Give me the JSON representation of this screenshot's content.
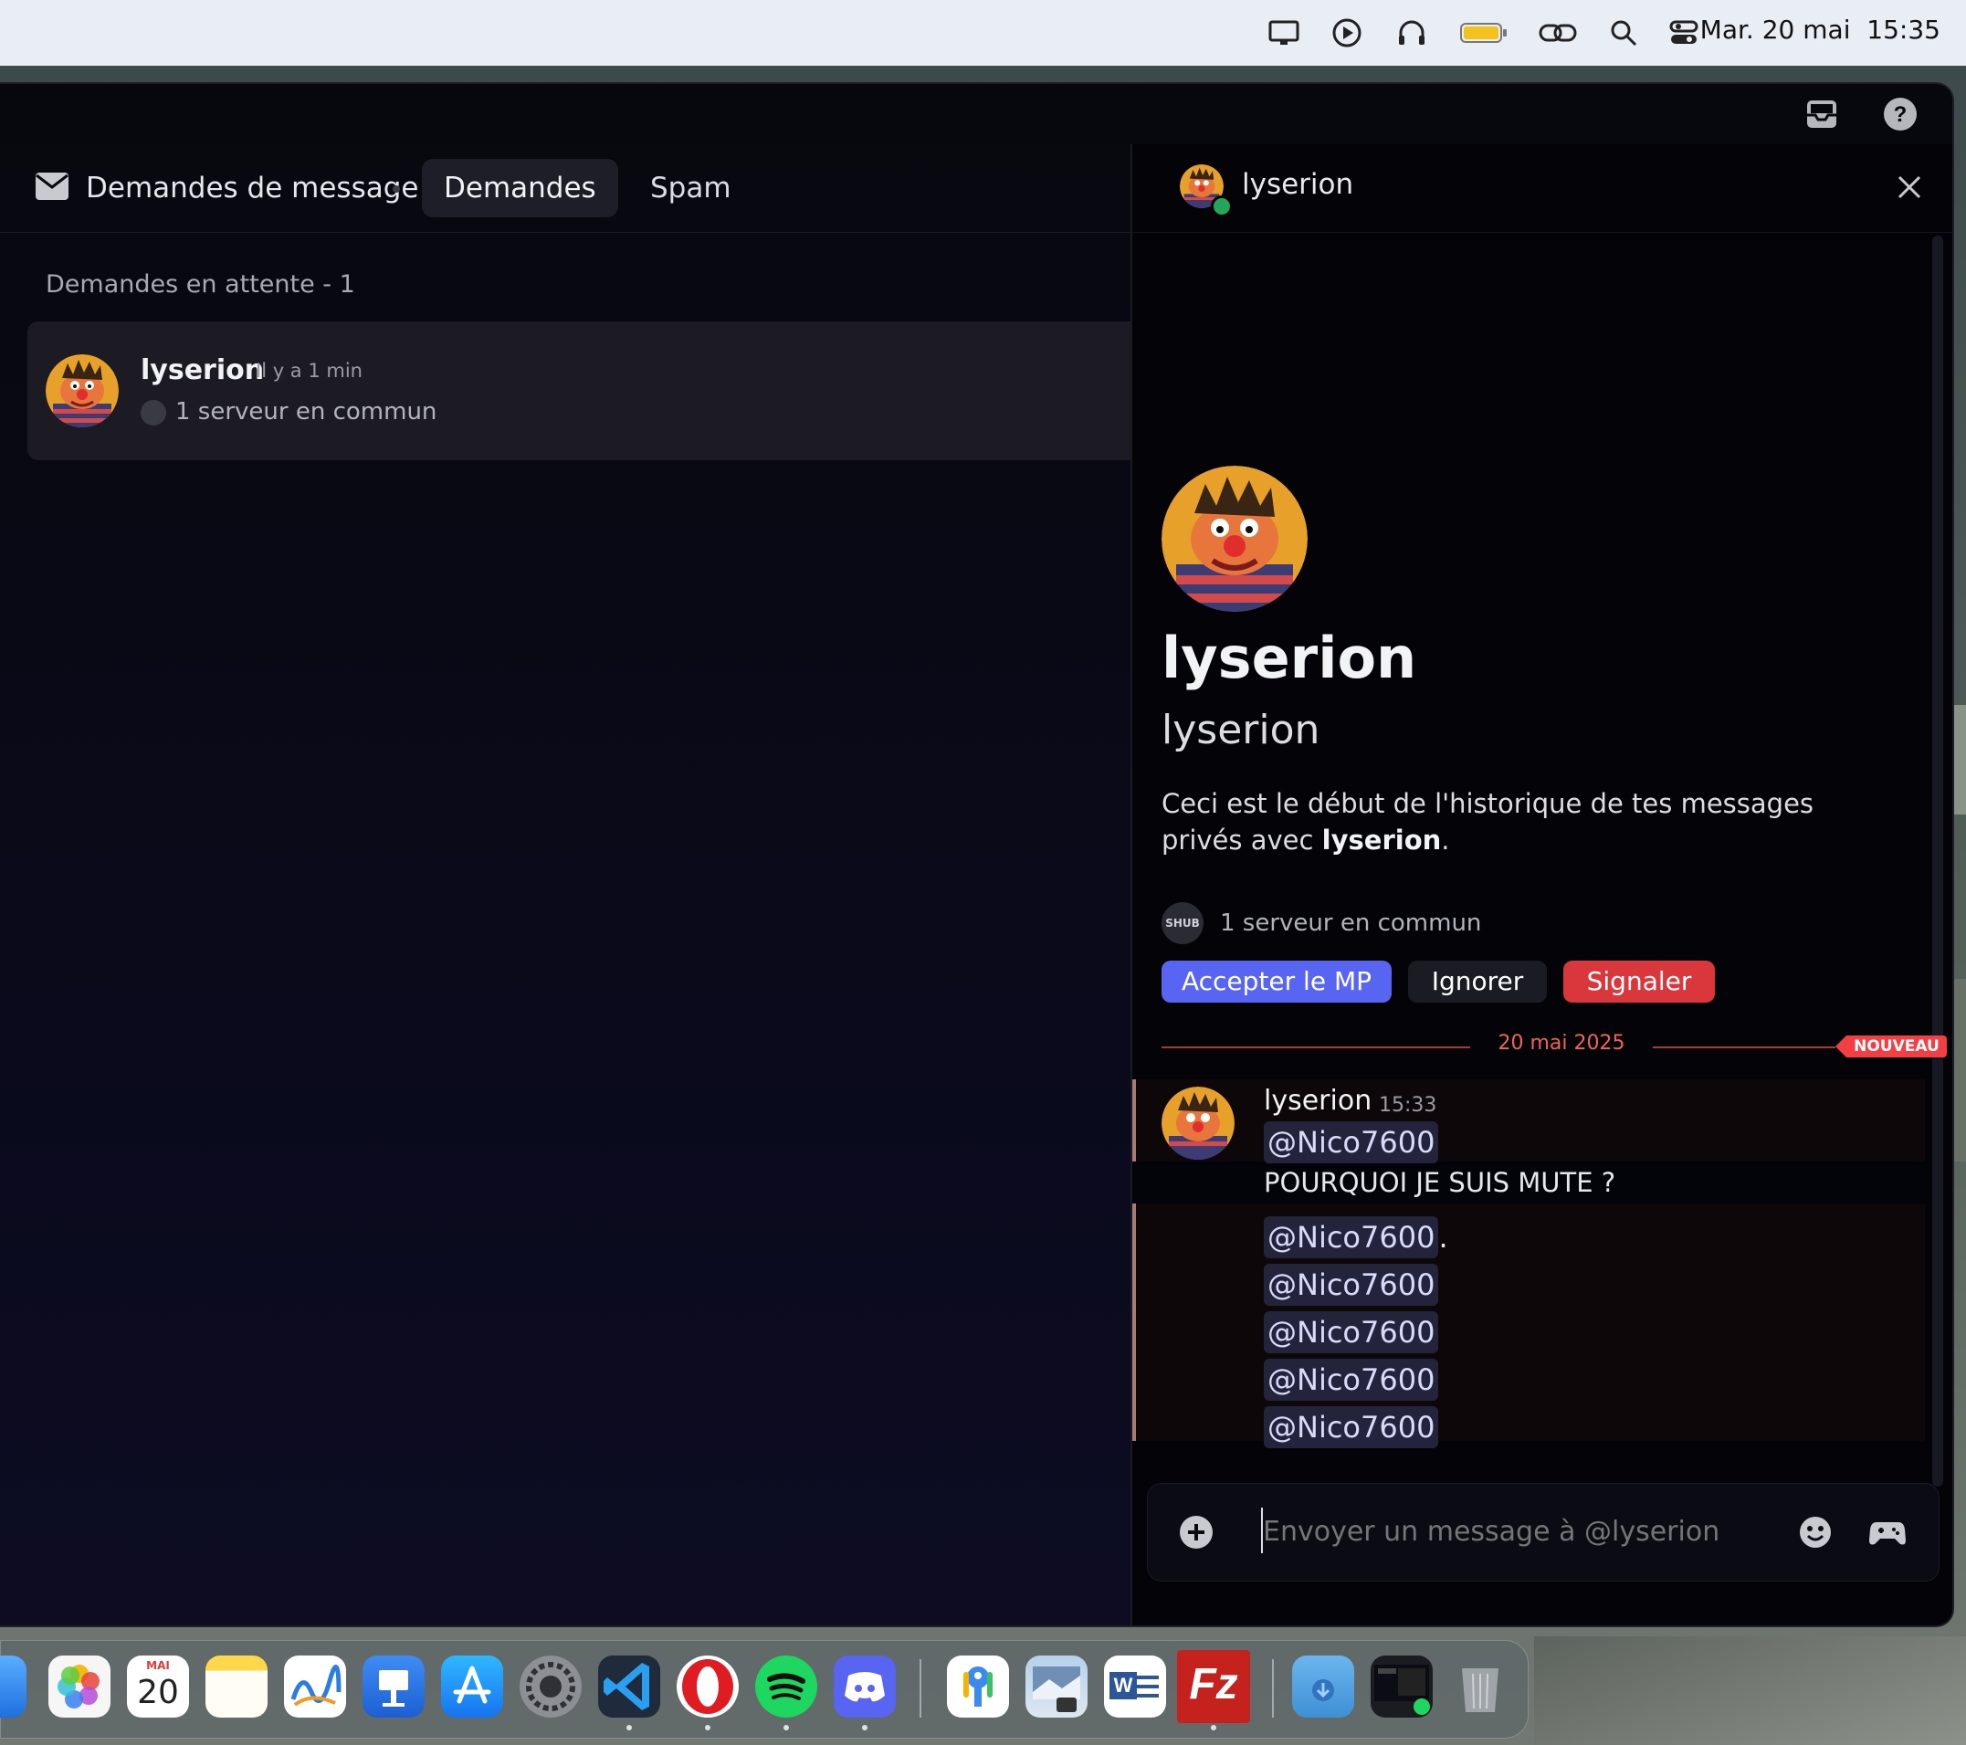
{
  "menubar": {
    "date": "Mar. 20 mai",
    "time": "15:35",
    "icons": [
      "display-icon",
      "play-circle-icon",
      "headphones-icon",
      "battery-icon",
      "link-icon",
      "search-icon",
      "control-center-icon"
    ]
  },
  "window": {
    "toolbar_icons": [
      "inbox-icon",
      "help-icon"
    ]
  },
  "left": {
    "header_title": "Demandes de message",
    "tabs": [
      {
        "label": "Demandes"
      },
      {
        "label": "Spam"
      }
    ],
    "section_title": "Demandes en attente - 1",
    "request": {
      "username": "lyserion",
      "time_ago": "Il y a 1 min",
      "mutual": "1 serveur en commun"
    }
  },
  "right": {
    "header_name": "lyserion",
    "profile_display_name": "lyserion",
    "profile_username": "lyserion",
    "intro_text": "Ceci est le début de l'historique de tes messages privés avec ",
    "intro_bold": "lyserion",
    "intro_end": ".",
    "server_badge": "SHUB",
    "mutual": "1 serveur en commun",
    "buttons": {
      "accept": "Accepter le MP",
      "ignore": "Ignorer",
      "report": "Signaler"
    },
    "divider_date": "20 mai 2025",
    "new_badge": "NOUVEAU",
    "message": {
      "author": "lyserion",
      "time": "15:33",
      "lines": [
        {
          "mention": "@Nico7600",
          "suffix": ""
        },
        {
          "text": "POURQUOI JE SUIS MUTE ?"
        },
        {
          "mention": "@Nico7600",
          "suffix": "."
        },
        {
          "mention": "@Nico7600",
          "suffix": ""
        },
        {
          "mention": "@Nico7600",
          "suffix": ""
        },
        {
          "mention": "@Nico7600",
          "suffix": ""
        },
        {
          "mention": "@Nico7600",
          "suffix": ""
        }
      ]
    },
    "composer_placeholder": "Envoyer un message à @lyserion"
  },
  "dock": {
    "calendar_month": "MAI",
    "calendar_day": "20",
    "word_letter": "W",
    "filezilla_letters": "Fz",
    "apps": [
      "mail",
      "photos",
      "calendar",
      "notes",
      "freeform",
      "keynote",
      "app-store",
      "system-settings",
      "vscode",
      "opera",
      "spotify",
      "discord",
      "passwords",
      "preview",
      "word",
      "filezilla",
      "downloads",
      "screen-recording",
      "trash"
    ]
  },
  "colors": {
    "blurple": "#5865f2",
    "danger": "#da373c",
    "new_red": "#f23f43",
    "online": "#23a55a"
  }
}
